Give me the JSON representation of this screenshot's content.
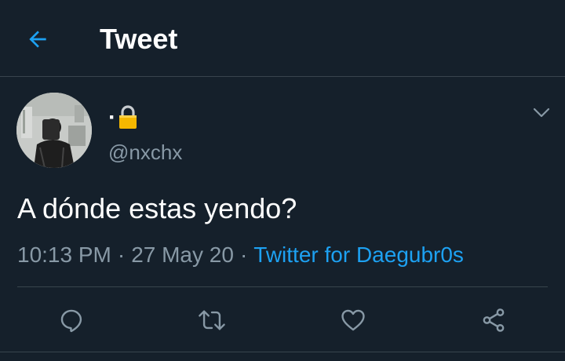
{
  "header": {
    "title": "Tweet",
    "back_icon": "arrow-left-icon"
  },
  "author": {
    "display_name": "·",
    "protected_icon": "lock-icon",
    "handle": "@nxchx"
  },
  "tweet": {
    "text": "A dónde estas yendo?",
    "time": "10:13 PM",
    "separator_1": "·",
    "date": "27 May 20",
    "separator_2": "·",
    "source": "Twitter for Daegubr0s"
  },
  "actions": [
    {
      "name": "reply",
      "icon": "reply-icon"
    },
    {
      "name": "retweet",
      "icon": "retweet-icon"
    },
    {
      "name": "like",
      "icon": "heart-icon"
    },
    {
      "name": "share",
      "icon": "share-icon"
    }
  ],
  "colors": {
    "background": "#15202b",
    "accent": "#1da1f2",
    "muted_text": "#8899a6",
    "divider": "#38444d"
  }
}
